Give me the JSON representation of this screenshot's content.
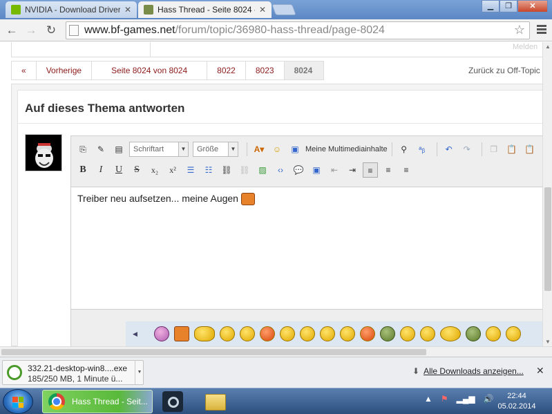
{
  "browser": {
    "tabs": [
      {
        "title": "NVIDIA - Download Driver",
        "active": false
      },
      {
        "title": "Hass Thread - Seite 8024 -",
        "active": true
      }
    ],
    "url_host": "www.bf-games.net",
    "url_path": "/forum/topic/36980-hass-thread/page-8024"
  },
  "page": {
    "melden": "Melden",
    "pager": {
      "first": "«",
      "prev": "Vorherige",
      "page_of": "Seite 8024 von 8024",
      "pages": [
        "8022",
        "8023",
        "8024"
      ],
      "current": "8024"
    },
    "back_link": "Zurück zu Off-Topic",
    "reply_title": "Auf dieses Thema antworten",
    "editor": {
      "font_select": "Schriftart",
      "size_select": "Größe",
      "media_label": "Meine Multimediainhalte",
      "text": "Treiber neu aufsetzen... meine Augen"
    }
  },
  "download": {
    "filename": "332.21-desktop-win8....exe",
    "status": "185/250 MB, 1 Minute ü...",
    "show_all": "Alle Downloads anzeigen..."
  },
  "taskbar": {
    "chrome_task": "Hass Thread - Seit...",
    "time": "22:44",
    "date": "05.02.2014"
  },
  "colors": {
    "link_red": "#8b1a1a",
    "smiley_orange": "#e8822a",
    "taskbar_blue": "#2c4f7e"
  }
}
